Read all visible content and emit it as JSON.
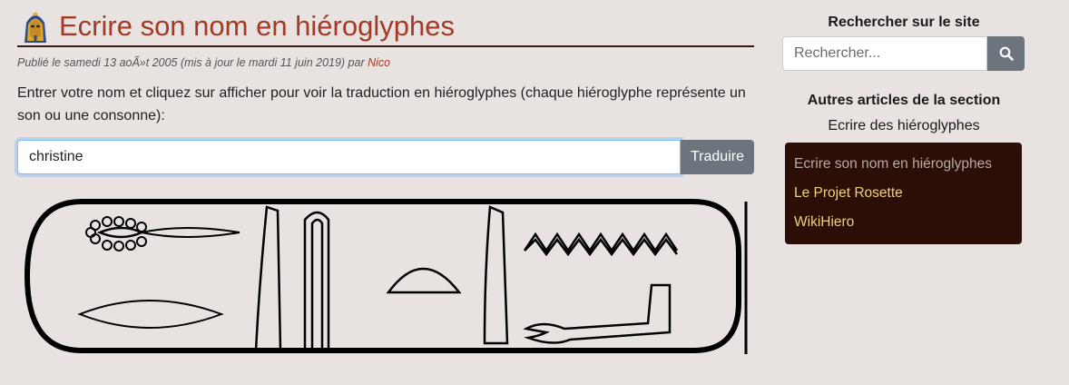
{
  "article": {
    "title": "Ecrire son nom en hiéroglyphes",
    "meta_prefix": "Publié le samedi 13 aoÃ»t 2005 (mis à jour le mardi 11 juin 2019) par ",
    "author": "Nico",
    "intro": "Entrer votre nom et cliquez sur afficher pour voir la traduction en hiéroglyphes (chaque hiéroglyphe représente un son ou une consonne):",
    "name_value": "christine",
    "translate_label": "Traduire"
  },
  "sidebar": {
    "search_heading": "Rechercher sur le site",
    "search_placeholder": "Rechercher...",
    "articles_heading": "Autres articles de la section",
    "section_name": "Ecrire des hiéroglyphes",
    "articles": [
      {
        "label": "Ecrire son nom en hiéroglyphes",
        "current": true
      },
      {
        "label": "Le Projet Rosette",
        "current": false
      },
      {
        "label": "WikiHiero",
        "current": false
      }
    ]
  },
  "icons": {
    "title_icon": "pharaoh-mask-icon",
    "search_icon": "search-icon"
  },
  "colors": {
    "background": "#e8e3e0",
    "title": "#a33a25",
    "button": "#6c757d",
    "sidebar_box": "#2b0f07",
    "link": "#f0d27a"
  }
}
